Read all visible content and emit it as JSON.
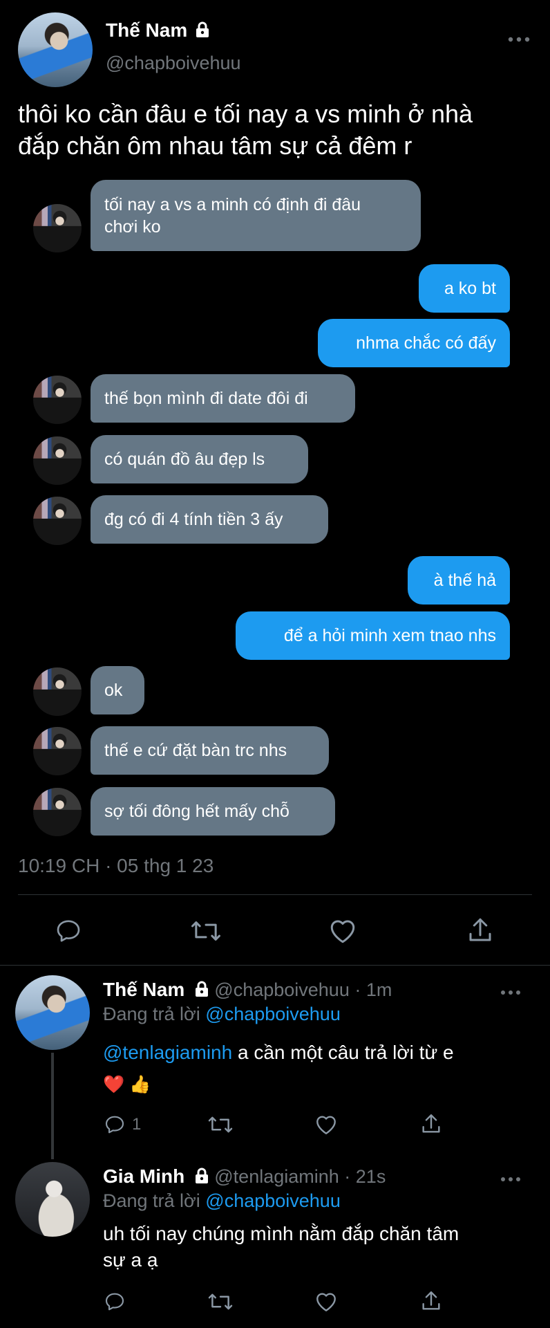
{
  "tweet": {
    "author_name": "Thế Nam",
    "author_handle": "@chapboivehuu",
    "text_line1": "thôi ko cần đâu e tối nay a vs minh ở nhà",
    "text_line2": "đắp chăn ôm nhau tâm sự cả đêm r",
    "timestamp": "10:19 CH · 05 thg 1 23"
  },
  "chat": {
    "m1_line1": "tối nay a vs a minh có định đi đâu",
    "m1_line2": "chơi ko",
    "m2": "a ko bt",
    "m3": "nhma chắc có đấy",
    "m4": "thế bọn mình đi date đôi đi",
    "m5": "có quán đồ âu đẹp ls",
    "m6": "đg có đi 4 tính tiền 3 ấy",
    "m7": "à thế hả",
    "m8": "để a hỏi minh xem tnao nhs",
    "m9": "ok",
    "m10": "thế e cứ đặt bàn trc nhs",
    "m11": "sợ tối đông hết mấy chỗ"
  },
  "reply1": {
    "name": "Thế Nam",
    "handle": "@chapboivehuu",
    "time": "· 1m",
    "replying_prefix": "Đang trả lời",
    "replying_to": "@chapboivehuu",
    "mention": "@tenlagiaminh",
    "text": " a cần một câu trả lời từ e",
    "emojis": "❤️ 👍",
    "reply_count": "1"
  },
  "reply2": {
    "name": "Gia Minh",
    "handle": "@tenlagiaminh",
    "time": "· 21s",
    "replying_prefix": "Đang trả lời",
    "replying_to": "@chapboivehuu",
    "text_line1": "uh tối nay chúng mình nằm đắp chăn tâm",
    "text_line2": "sự a ạ"
  },
  "colors": {
    "accent": "#1d9bf0",
    "incoming_bubble": "#657786",
    "muted": "#71767b"
  }
}
